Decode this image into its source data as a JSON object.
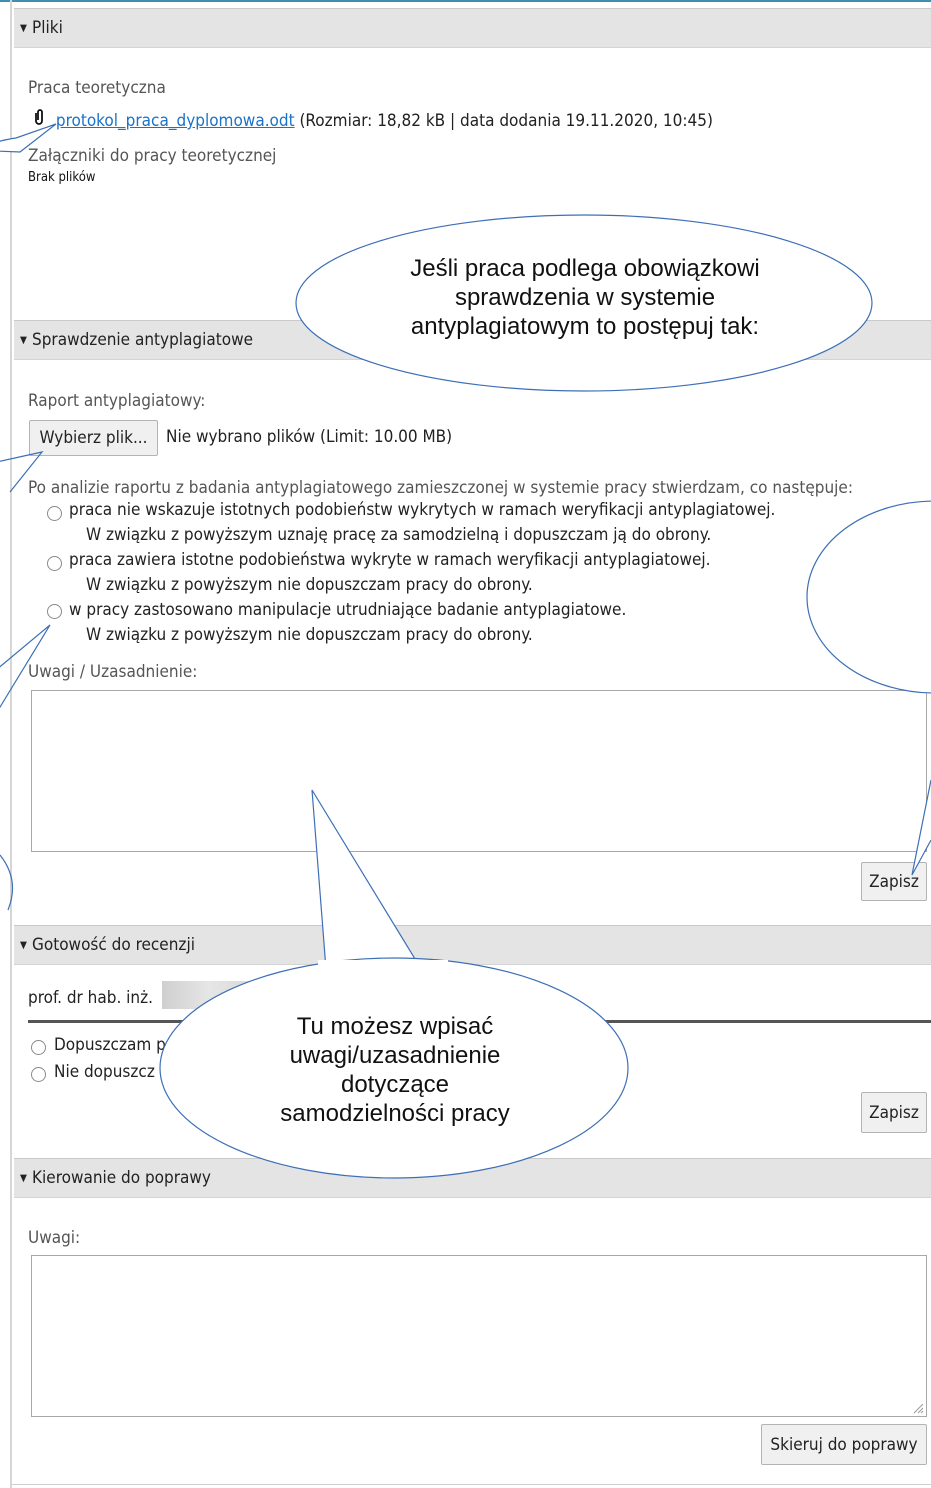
{
  "sections": {
    "pliki": {
      "title": "Pliki",
      "praca_label": "Praca teoretyczna",
      "file_link": "protokol_praca_dyplomowa.odt",
      "file_meta": "(Rozmiar: 18,82 kB | data dodania 19.11.2020, 10:45)",
      "attachments_label": "Załączniki do pracy teoretycznej",
      "no_files": "Brak plików"
    },
    "antyplagiat": {
      "title": "Sprawdzenie antyplagiatowe",
      "report_label": "Raport antyplagiatowy:",
      "choose_file_button": "Wybierz plik...",
      "no_file_text": "Nie wybrano plików (Limit: 10.00 MB)",
      "intro": "Po analizie raportu z badania antyplagiatowego zamieszczonej w systemie pracy stwierdzam, co następuje:",
      "options": [
        {
          "line1": "praca nie wskazuje istotnych podobieństw wykrytych w ramach weryfikacji antyplagiatowej.",
          "line2": "W związku z powyższym uznaję pracę za samodzielną i dopuszczam ją do obrony."
        },
        {
          "line1": "praca zawiera istotne podobieństwa wykryte w ramach weryfikacji antyplagiatowej.",
          "line2": "W związku z powyższym nie dopuszczam pracy do obrony."
        },
        {
          "line1": "w pracy zastosowano manipulacje utrudniające badanie antyplagiatowe.",
          "line2": "W związku z powyższym nie dopuszczam pracy do obrony."
        }
      ],
      "uwagi_label": "Uwagi / Uzasadnienie:",
      "save_button": "Zapisz"
    },
    "gotowosc": {
      "title": "Gotowość do recenzji",
      "person": "prof. dr hab. inż.",
      "option1": "Dopuszczam p",
      "option2": "Nie dopuszcz",
      "save_button": "Zapisz"
    },
    "kierowanie": {
      "title": "Kierowanie do poprawy",
      "uwagi_label": "Uwagi:",
      "submit_button": "Skieruj do poprawy"
    }
  },
  "callouts": {
    "top": [
      "Jeśli praca podlega obowiązkowi",
      "sprawdzenia w systemie",
      "antyplagiatowym to postępuj tak:"
    ],
    "bottom": [
      "Tu możesz wpisać",
      "uwagi/uzasadnienie",
      "dotyczące",
      "samodzielności pracy"
    ]
  }
}
